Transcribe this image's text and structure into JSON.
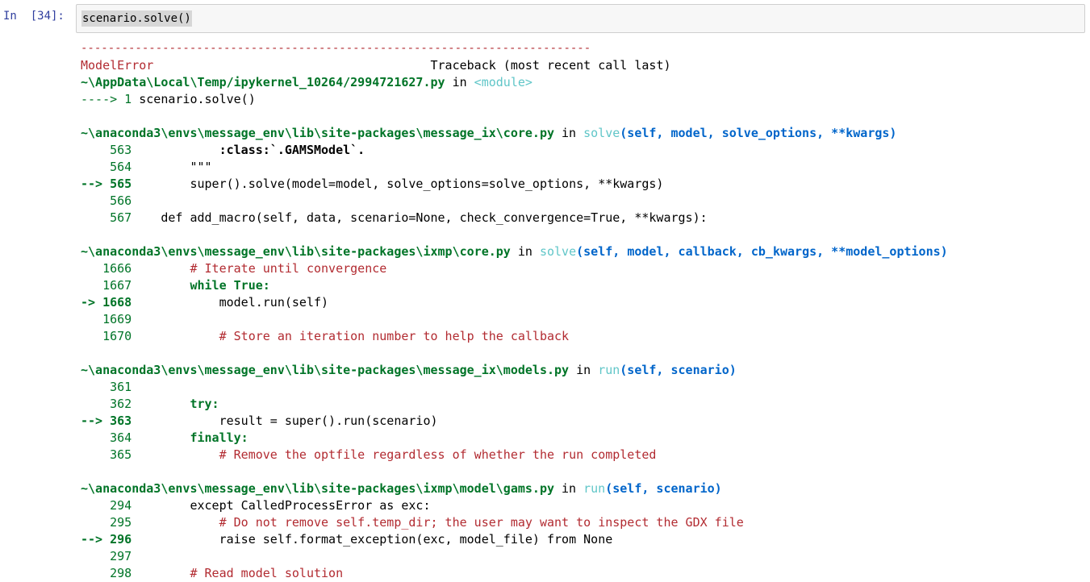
{
  "prompt": "In  [34]:",
  "input_code": "scenario.solve()",
  "dash_line": "---------------------------------------------------------------------------",
  "error_name": "ModelError",
  "traceback_header": "Traceback (most recent call last)",
  "frame0": {
    "path": "~\\AppData\\Local\\Temp/ipykernel_10264/2994721627.py",
    "in_word": " in ",
    "func": "<module>",
    "lines": [
      {
        "prefix": "----> 1 ",
        "code": "scenario.solve()"
      }
    ]
  },
  "frame1": {
    "path": "~\\anaconda3\\envs\\message_env\\lib\\site-packages\\message_ix\\core.py",
    "in_word": " in ",
    "func": "solve",
    "args": "(self, model, solve_options, **kwargs)",
    "lines": [
      {
        "num": "    563",
        "code": "            :class:`.GAMSModel`."
      },
      {
        "num": "    564",
        "code": "        \"\"\""
      },
      {
        "num": "--> 565",
        "code": "        super().solve(model=model, solve_options=solve_options, **kwargs)"
      },
      {
        "num": "    566",
        "code": ""
      },
      {
        "num": "    567",
        "code": "    def add_macro(self, data, scenario=None, check_convergence=True, **kwargs):"
      }
    ]
  },
  "frame2": {
    "path": "~\\anaconda3\\envs\\message_env\\lib\\site-packages\\ixmp\\core.py",
    "in_word": " in ",
    "func": "solve",
    "args": "(self, model, callback, cb_kwargs, **model_options)",
    "lines": [
      {
        "num": "   1666",
        "code": "        # Iterate until convergence"
      },
      {
        "num": "   1667",
        "code": "        while True:"
      },
      {
        "num": "-> 1668",
        "code": "            model.run(self)"
      },
      {
        "num": "   1669",
        "code": ""
      },
      {
        "num": "   1670",
        "code": "            # Store an iteration number to help the callback"
      }
    ]
  },
  "frame3": {
    "path": "~\\anaconda3\\envs\\message_env\\lib\\site-packages\\message_ix\\models.py",
    "in_word": " in ",
    "func": "run",
    "args": "(self, scenario)",
    "lines": [
      {
        "num": "    361",
        "code": ""
      },
      {
        "num": "    362",
        "code": "        try:"
      },
      {
        "num": "--> 363",
        "code": "            result = super().run(scenario)"
      },
      {
        "num": "    364",
        "code": "        finally:"
      },
      {
        "num": "    365",
        "code": "            # Remove the optfile regardless of whether the run completed"
      }
    ]
  },
  "frame4": {
    "path": "~\\anaconda3\\envs\\message_env\\lib\\site-packages\\ixmp\\model\\gams.py",
    "in_word": " in ",
    "func": "run",
    "args": "(self, scenario)",
    "lines": [
      {
        "num": "    294",
        "code": "        except CalledProcessError as exc:"
      },
      {
        "num": "    295",
        "code": "            # Do not remove self.temp_dir; the user may want to inspect the GDX file"
      },
      {
        "num": "--> 296",
        "code": "            raise self.format_exception(exc, model_file) from None"
      },
      {
        "num": "    297",
        "code": ""
      },
      {
        "num": "    298",
        "code": "        # Read model solution"
      }
    ]
  }
}
